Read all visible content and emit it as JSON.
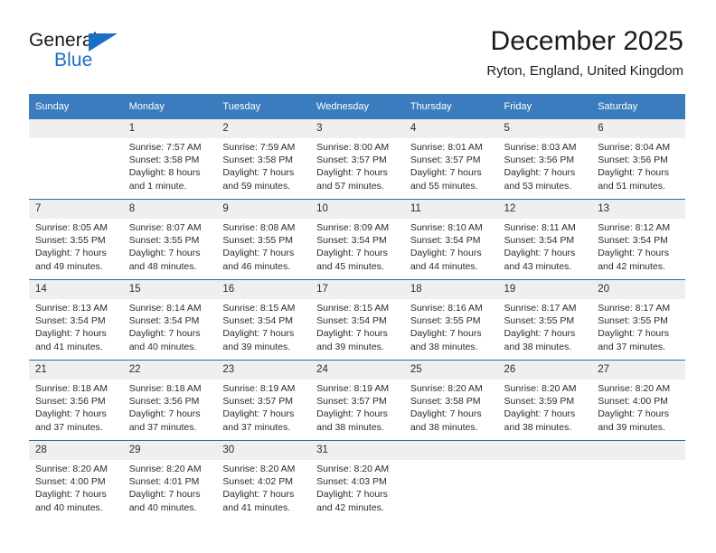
{
  "brand": {
    "name_part1": "General",
    "name_part2": "Blue",
    "logo_icon": "triangle-flag-icon",
    "accent_color": "#1a6fc4"
  },
  "header": {
    "title": "December 2025",
    "subtitle": "Ryton, England, United Kingdom"
  },
  "calendar": {
    "header_color": "#3a7cbd",
    "daynum_band_color": "#efefef",
    "week_separator_color": "#2e6da4",
    "weekdays": [
      "Sunday",
      "Monday",
      "Tuesday",
      "Wednesday",
      "Thursday",
      "Friday",
      "Saturday"
    ],
    "weeks": [
      [
        {
          "day": "",
          "lines": []
        },
        {
          "day": "1",
          "lines": [
            "Sunrise: 7:57 AM",
            "Sunset: 3:58 PM",
            "Daylight: 8 hours",
            "and 1 minute."
          ]
        },
        {
          "day": "2",
          "lines": [
            "Sunrise: 7:59 AM",
            "Sunset: 3:58 PM",
            "Daylight: 7 hours",
            "and 59 minutes."
          ]
        },
        {
          "day": "3",
          "lines": [
            "Sunrise: 8:00 AM",
            "Sunset: 3:57 PM",
            "Daylight: 7 hours",
            "and 57 minutes."
          ]
        },
        {
          "day": "4",
          "lines": [
            "Sunrise: 8:01 AM",
            "Sunset: 3:57 PM",
            "Daylight: 7 hours",
            "and 55 minutes."
          ]
        },
        {
          "day": "5",
          "lines": [
            "Sunrise: 8:03 AM",
            "Sunset: 3:56 PM",
            "Daylight: 7 hours",
            "and 53 minutes."
          ]
        },
        {
          "day": "6",
          "lines": [
            "Sunrise: 8:04 AM",
            "Sunset: 3:56 PM",
            "Daylight: 7 hours",
            "and 51 minutes."
          ]
        }
      ],
      [
        {
          "day": "7",
          "lines": [
            "Sunrise: 8:05 AM",
            "Sunset: 3:55 PM",
            "Daylight: 7 hours",
            "and 49 minutes."
          ]
        },
        {
          "day": "8",
          "lines": [
            "Sunrise: 8:07 AM",
            "Sunset: 3:55 PM",
            "Daylight: 7 hours",
            "and 48 minutes."
          ]
        },
        {
          "day": "9",
          "lines": [
            "Sunrise: 8:08 AM",
            "Sunset: 3:55 PM",
            "Daylight: 7 hours",
            "and 46 minutes."
          ]
        },
        {
          "day": "10",
          "lines": [
            "Sunrise: 8:09 AM",
            "Sunset: 3:54 PM",
            "Daylight: 7 hours",
            "and 45 minutes."
          ]
        },
        {
          "day": "11",
          "lines": [
            "Sunrise: 8:10 AM",
            "Sunset: 3:54 PM",
            "Daylight: 7 hours",
            "and 44 minutes."
          ]
        },
        {
          "day": "12",
          "lines": [
            "Sunrise: 8:11 AM",
            "Sunset: 3:54 PM",
            "Daylight: 7 hours",
            "and 43 minutes."
          ]
        },
        {
          "day": "13",
          "lines": [
            "Sunrise: 8:12 AM",
            "Sunset: 3:54 PM",
            "Daylight: 7 hours",
            "and 42 minutes."
          ]
        }
      ],
      [
        {
          "day": "14",
          "lines": [
            "Sunrise: 8:13 AM",
            "Sunset: 3:54 PM",
            "Daylight: 7 hours",
            "and 41 minutes."
          ]
        },
        {
          "day": "15",
          "lines": [
            "Sunrise: 8:14 AM",
            "Sunset: 3:54 PM",
            "Daylight: 7 hours",
            "and 40 minutes."
          ]
        },
        {
          "day": "16",
          "lines": [
            "Sunrise: 8:15 AM",
            "Sunset: 3:54 PM",
            "Daylight: 7 hours",
            "and 39 minutes."
          ]
        },
        {
          "day": "17",
          "lines": [
            "Sunrise: 8:15 AM",
            "Sunset: 3:54 PM",
            "Daylight: 7 hours",
            "and 39 minutes."
          ]
        },
        {
          "day": "18",
          "lines": [
            "Sunrise: 8:16 AM",
            "Sunset: 3:55 PM",
            "Daylight: 7 hours",
            "and 38 minutes."
          ]
        },
        {
          "day": "19",
          "lines": [
            "Sunrise: 8:17 AM",
            "Sunset: 3:55 PM",
            "Daylight: 7 hours",
            "and 38 minutes."
          ]
        },
        {
          "day": "20",
          "lines": [
            "Sunrise: 8:17 AM",
            "Sunset: 3:55 PM",
            "Daylight: 7 hours",
            "and 37 minutes."
          ]
        }
      ],
      [
        {
          "day": "21",
          "lines": [
            "Sunrise: 8:18 AM",
            "Sunset: 3:56 PM",
            "Daylight: 7 hours",
            "and 37 minutes."
          ]
        },
        {
          "day": "22",
          "lines": [
            "Sunrise: 8:18 AM",
            "Sunset: 3:56 PM",
            "Daylight: 7 hours",
            "and 37 minutes."
          ]
        },
        {
          "day": "23",
          "lines": [
            "Sunrise: 8:19 AM",
            "Sunset: 3:57 PM",
            "Daylight: 7 hours",
            "and 37 minutes."
          ]
        },
        {
          "day": "24",
          "lines": [
            "Sunrise: 8:19 AM",
            "Sunset: 3:57 PM",
            "Daylight: 7 hours",
            "and 38 minutes."
          ]
        },
        {
          "day": "25",
          "lines": [
            "Sunrise: 8:20 AM",
            "Sunset: 3:58 PM",
            "Daylight: 7 hours",
            "and 38 minutes."
          ]
        },
        {
          "day": "26",
          "lines": [
            "Sunrise: 8:20 AM",
            "Sunset: 3:59 PM",
            "Daylight: 7 hours",
            "and 38 minutes."
          ]
        },
        {
          "day": "27",
          "lines": [
            "Sunrise: 8:20 AM",
            "Sunset: 4:00 PM",
            "Daylight: 7 hours",
            "and 39 minutes."
          ]
        }
      ],
      [
        {
          "day": "28",
          "lines": [
            "Sunrise: 8:20 AM",
            "Sunset: 4:00 PM",
            "Daylight: 7 hours",
            "and 40 minutes."
          ]
        },
        {
          "day": "29",
          "lines": [
            "Sunrise: 8:20 AM",
            "Sunset: 4:01 PM",
            "Daylight: 7 hours",
            "and 40 minutes."
          ]
        },
        {
          "day": "30",
          "lines": [
            "Sunrise: 8:20 AM",
            "Sunset: 4:02 PM",
            "Daylight: 7 hours",
            "and 41 minutes."
          ]
        },
        {
          "day": "31",
          "lines": [
            "Sunrise: 8:20 AM",
            "Sunset: 4:03 PM",
            "Daylight: 7 hours",
            "and 42 minutes."
          ]
        },
        {
          "day": "",
          "lines": []
        },
        {
          "day": "",
          "lines": []
        },
        {
          "day": "",
          "lines": []
        }
      ]
    ]
  }
}
